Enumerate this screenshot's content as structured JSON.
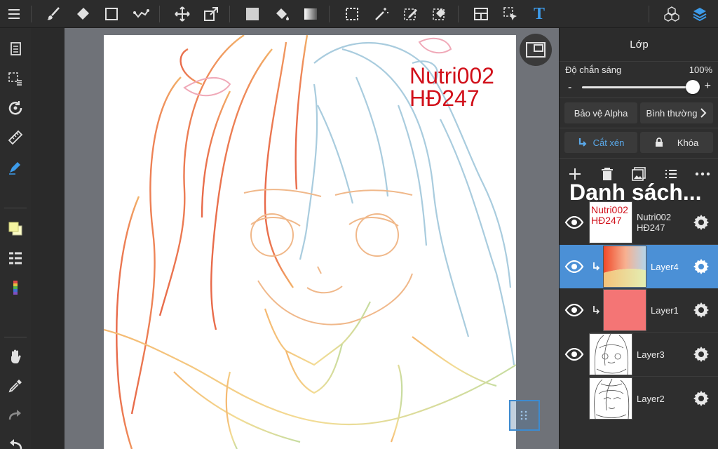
{
  "toolbar": {
    "tools": [
      "menu-icon",
      "brush-icon",
      "eraser-icon",
      "rectangle-icon",
      "line-icon",
      "move-icon",
      "transform-icon",
      "fill-color-icon",
      "bucket-icon",
      "gradient-icon",
      "select-rect-icon",
      "magic-wand-icon",
      "select-pen-icon",
      "select-eraser-icon",
      "layout-icon",
      "select-arrow-icon",
      "text-icon",
      "3d-material-icon",
      "layers-icon"
    ],
    "text_tool_glyph": "T",
    "accent": "#3d9be9"
  },
  "lefttools": [
    "pages-icon",
    "selection-list-icon",
    "rotate-icon",
    "ruler-icon",
    "pen-active-icon",
    "color-swatch-icon",
    "layer-list-icon",
    "color-bars-icon",
    "hand-icon",
    "eyedropper-icon",
    "redo-icon",
    "undo-icon"
  ],
  "canvas": {
    "watermark_line1": "Nutri002",
    "watermark_line2": "HĐ247",
    "watermark_color": "#d1101a"
  },
  "panel": {
    "title": "Lớp",
    "opacity_label": "Độ chắn sáng",
    "opacity_value": "100%",
    "opacity_fraction": 1.0,
    "minus": "-",
    "plus": "+",
    "alpha_protect": "Bảo vệ Alpha",
    "blend_mode": "Bình thường",
    "clipping": "Cắt xén",
    "lock": "Khóa",
    "list_title": "Danh sách...",
    "actions": [
      "add-layer-icon",
      "delete-layer-icon",
      "image-layer-icon",
      "list-icon",
      "more-icon"
    ]
  },
  "layers": [
    {
      "name_line1": "Nutri002",
      "name_line2": "HĐ247",
      "thumb_line1": "Nutri002",
      "thumb_line2": "HĐ247",
      "visible": true,
      "selected": false,
      "clipped": false
    },
    {
      "name_line1": "Layer4",
      "name_line2": "",
      "visible": true,
      "selected": true,
      "clipped": true
    },
    {
      "name_line1": "Layer1",
      "name_line2": "",
      "visible": true,
      "selected": false,
      "clipped": true
    },
    {
      "name_line1": "Layer3",
      "name_line2": "",
      "visible": true,
      "selected": false,
      "clipped": false
    },
    {
      "name_line1": "Layer2",
      "name_line2": "",
      "visible": false,
      "selected": false,
      "clipped": false
    }
  ]
}
